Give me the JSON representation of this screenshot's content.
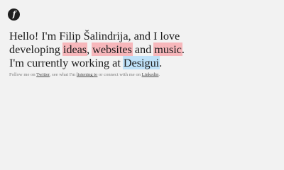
{
  "logo": {
    "glyph": "f"
  },
  "headline": {
    "line1": "Hello! I'm Filip Šalindrija, and I love",
    "line2_prefix": "developing ",
    "ideas": "ideas",
    "comma1": ", ",
    "websites": "websites",
    "and": " and ",
    "music": "music",
    "period1": ".",
    "line3_prefix": "I'm currently working at ",
    "company": "Desigui",
    "period2": "."
  },
  "footer": {
    "text1": "Follow me on ",
    "twitter": "Twitter",
    "text2": ", see what I'm ",
    "listening": "listening to",
    "text3": " or connect with me on ",
    "linkedin": "Linkedin",
    "text4": "."
  },
  "colors": {
    "background": "#f2f2f2",
    "highlight_red": "#f7b7bb",
    "highlight_blue": "#bfe1f8",
    "text": "#1b1b1b",
    "muted": "#7b7b7b"
  }
}
